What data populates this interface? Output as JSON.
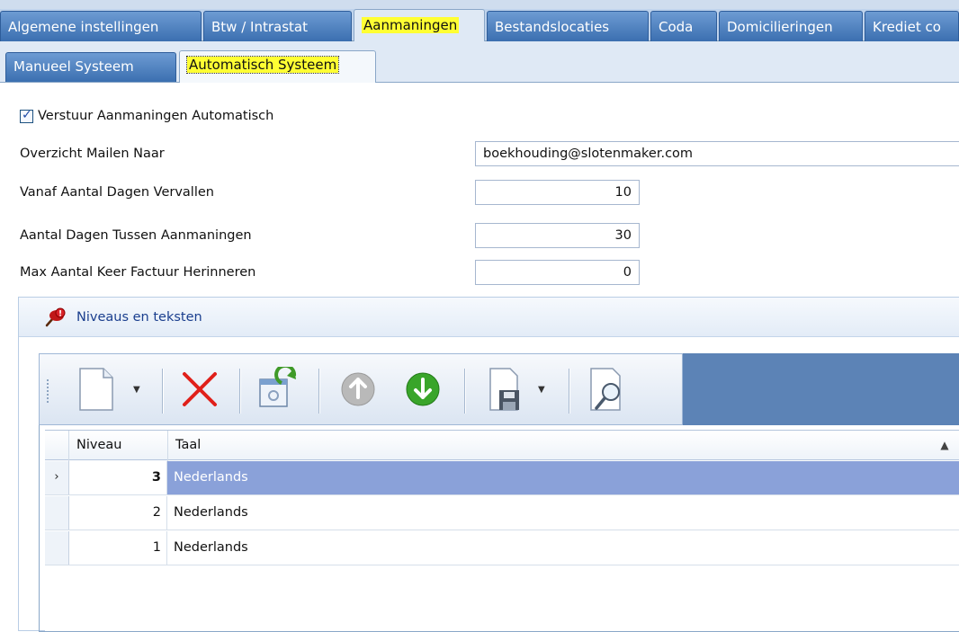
{
  "main_tabs": [
    {
      "label": "Algemene instellingen",
      "active": false
    },
    {
      "label": "Btw / Intrastat",
      "active": false
    },
    {
      "label": "Aanmaningen",
      "active": true
    },
    {
      "label": "Bestandslocaties",
      "active": false
    },
    {
      "label": "Coda",
      "active": false
    },
    {
      "label": "Domicilieringen",
      "active": false
    },
    {
      "label": "Krediet co",
      "active": false
    }
  ],
  "sub_tabs": [
    {
      "label": "Manueel Systeem",
      "active": false
    },
    {
      "label": "Automatisch Systeem",
      "active": true
    }
  ],
  "form": {
    "send_auto_label": "Verstuur Aanmaningen Automatisch",
    "send_auto_checked": true,
    "mail_label": "Overzicht Mailen Naar",
    "mail_value": "boekhouding@slotenmaker.com",
    "days_expired_label": "Vanaf Aantal Dagen Vervallen",
    "days_expired_value": "10",
    "days_between_label": "Aantal Dagen Tussen Aanmaningen",
    "days_between_value": "30",
    "max_reminders_label": "Max Aantal Keer Factuur Herinneren",
    "max_reminders_value": "0"
  },
  "group": {
    "title": "Niveaus en teksten",
    "icon": "pin-warning-icon"
  },
  "toolbar": {
    "icons": [
      "new-document-icon",
      "delete-icon",
      "refresh-settings-icon",
      "move-up-icon",
      "move-down-icon",
      "save-icon",
      "preview-icon"
    ]
  },
  "grid": {
    "columns": [
      "Niveau",
      "Taal"
    ],
    "row_indicator": "›",
    "sort_indicator": "▲",
    "rows": [
      {
        "niveau": "3",
        "taal": "Nederlands",
        "selected": true
      },
      {
        "niveau": "2",
        "taal": "Nederlands",
        "selected": false
      },
      {
        "niveau": "1",
        "taal": "Nederlands",
        "selected": false
      }
    ]
  },
  "colors": {
    "tab_blue": "#3b6fb0",
    "highlight": "#ffff33",
    "selected_row": "#8aa1d9",
    "toolbar_fill": "#5c83b6"
  }
}
